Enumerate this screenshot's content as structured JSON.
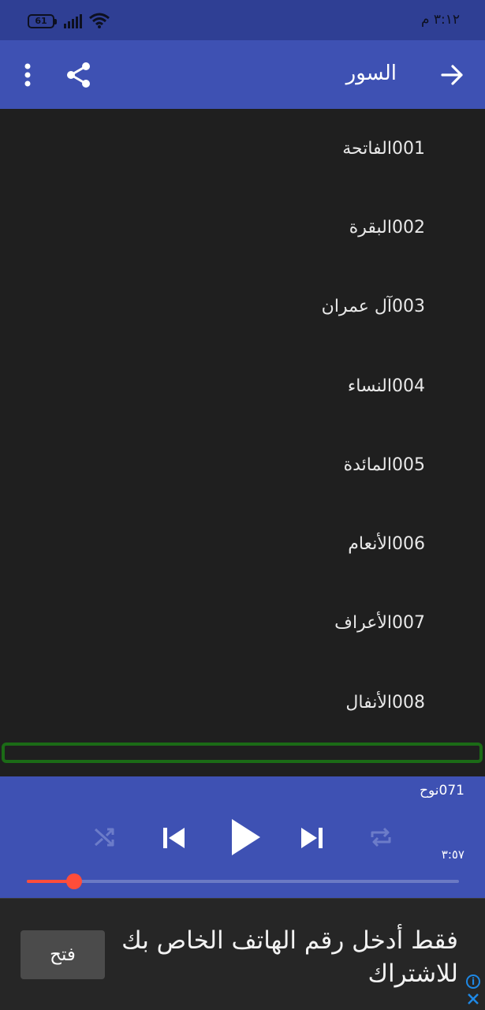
{
  "status_bar": {
    "battery": "61",
    "time": "٣:١٢ م",
    "icons": [
      "battery-icon",
      "signal-icon",
      "wifi-icon"
    ]
  },
  "app_bar": {
    "title": "السور",
    "icons": [
      "back-arrow-icon",
      "share-icon",
      "more-vert-icon"
    ]
  },
  "surahs": [
    "001الفاتحة",
    "002البقرة",
    "003آل عمران",
    "004النساء",
    "005المائدة",
    "006الأنعام",
    "007الأعراف",
    "008الأنفال"
  ],
  "player": {
    "now_playing": "071نوح",
    "duration": "٣:٥٧",
    "progress_fraction": 0.11,
    "controls": [
      "shuffle-icon",
      "skip-previous-icon",
      "play-icon",
      "skip-next-icon",
      "repeat-icon"
    ]
  },
  "ad": {
    "text": "فقط أدخل رقم الهاتف الخاص بك للاشتراك",
    "button_label": "فتح",
    "info_glyph": "i"
  },
  "colors": {
    "status_bar": "#2f3f94",
    "app_bar": "#3e51b3",
    "list_background": "#1f1f1f",
    "player_background": "#3e51b3",
    "progress": "#ff4d3a",
    "highlight_border": "#1b6b16",
    "ad_background": "#262626"
  }
}
